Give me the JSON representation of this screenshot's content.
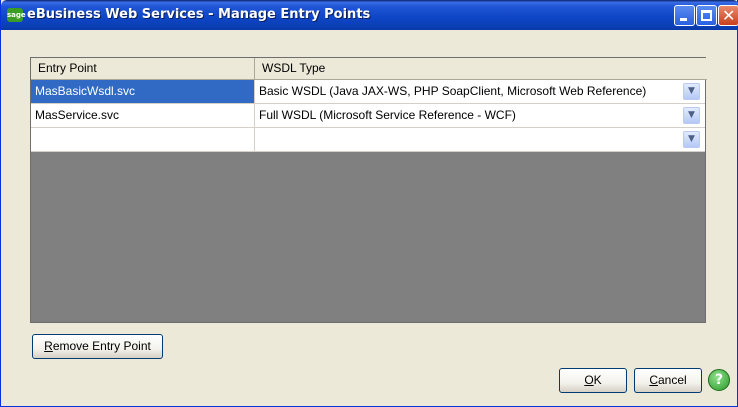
{
  "window": {
    "app_logo": "sage",
    "title": "eBusiness Web Services - Manage Entry Points",
    "controls": {
      "minimize_icon": "minimize-icon",
      "maximize_icon": "maximize-icon",
      "close_glyph": "✕"
    }
  },
  "grid": {
    "columns": [
      "Entry Point",
      "WSDL Type"
    ],
    "rows": [
      {
        "entry_point": "MasBasicWsdl.svc",
        "wsdl_type": "Basic WSDL (Java JAX-WS, PHP SoapClient, Microsoft Web Reference)",
        "selected": true
      },
      {
        "entry_point": "MasService.svc",
        "wsdl_type": "Full WSDL (Microsoft Service Reference - WCF)",
        "selected": false
      },
      {
        "entry_point": "",
        "wsdl_type": "",
        "selected": false
      }
    ],
    "dropdown_glyph": "▼"
  },
  "buttons": {
    "remove_prefix": "",
    "remove_mnemonic": "R",
    "remove_rest": "emove Entry Point",
    "ok_mnemonic": "O",
    "ok_rest": "K",
    "cancel_mnemonic": "C",
    "cancel_rest": "ancel",
    "help_glyph": "?"
  },
  "colors": {
    "titlebar": "#0a39a8",
    "selection": "#316ac5",
    "grid_background": "#808080",
    "dialog_background": "#ece9d8"
  }
}
